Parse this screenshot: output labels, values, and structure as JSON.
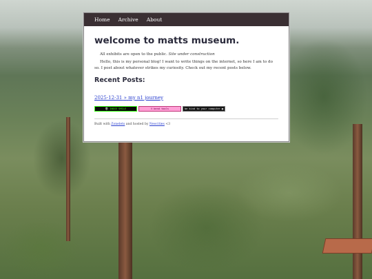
{
  "nav": {
    "items": [
      "Home",
      "Archive",
      "About"
    ]
  },
  "header": {
    "title": "welcome to matts museum."
  },
  "intro": {
    "line1_text": "All exhibits are open to the public.",
    "line1_note": "Site under construction",
    "line2": "Hello, this is my personal blog! I want to write things on the internet, so here I am to do so. I post about whatever strikes my curiosity. Check out my recent posts below."
  },
  "recent_posts": {
    "title": "Recent Posts:",
    "items": [
      {
        "date": "2025-12-31",
        "sep": "»",
        "title": "my n1 journey"
      }
    ]
  },
  "badges": [
    {
      "label": "INDIE'SMILE",
      "icon": "alien-icon"
    },
    {
      "label": "bend tools",
      "icon": "face-icon"
    },
    {
      "label": "be kind to your computer",
      "icon": "computer-icon"
    }
  ],
  "footer": {
    "built_with": "Built with",
    "zonelets": "Zonelets",
    "hosted_by": "and hosted by",
    "neocities": "Neocities",
    "heart": "<3"
  },
  "colors": {
    "navbar": "#3a2f33",
    "title": "#2b2b3c",
    "link": "#2a3fcf"
  }
}
